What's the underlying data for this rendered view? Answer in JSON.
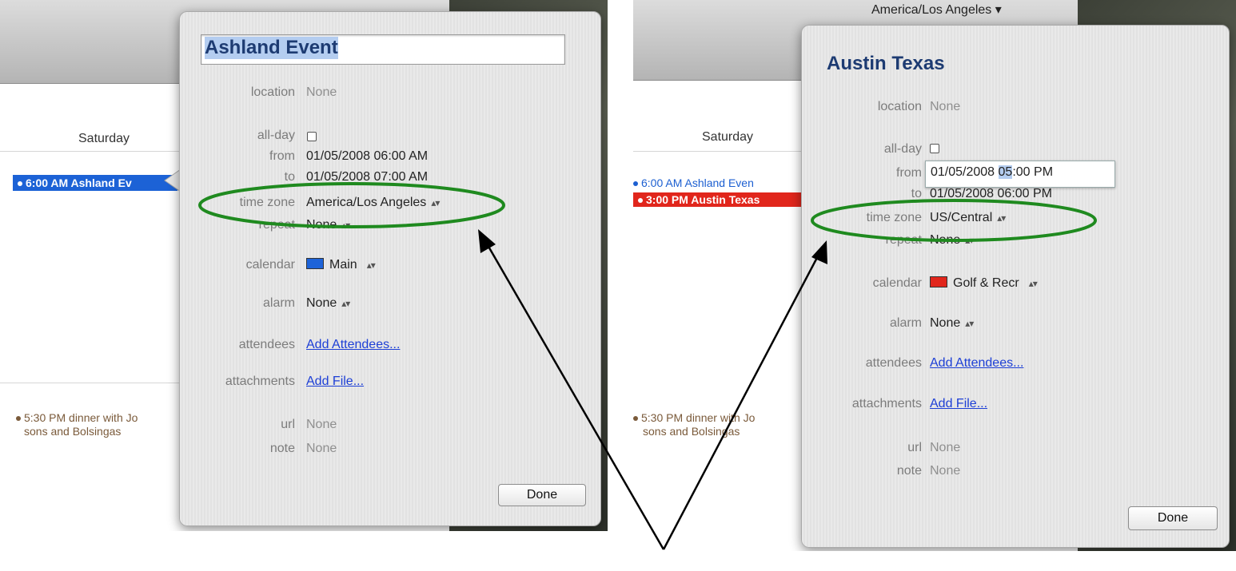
{
  "left": {
    "calendar": {
      "day_name": "Saturday",
      "event_selected": "6:00 AM Ashland Ev",
      "event_dinner_line1": "5:30 PM dinner with Jo",
      "event_dinner_line2": "sons and Bolsingas",
      "colors": {
        "selected_event": "#1c62d6",
        "dinner_event": "#7a5a3a"
      }
    },
    "popover": {
      "title": "Ashland Event",
      "labels": {
        "location": "location",
        "all_day": "all-day",
        "from": "from",
        "to": "to",
        "time_zone": "time zone",
        "repeat": "repeat",
        "calendar": "calendar",
        "alarm": "alarm",
        "attendees": "attendees",
        "attachments": "attachments",
        "url": "url",
        "note": "note"
      },
      "values": {
        "location": "None",
        "all_day_checked": false,
        "from": "01/05/2008 06:00 AM",
        "to": "01/05/2008 07:00 AM",
        "time_zone": "America/Los Angeles",
        "repeat": "None",
        "calendar": "Main",
        "calendar_color": "#1d63d8",
        "alarm": "None",
        "attendees": "Add Attendees...",
        "attachments": "Add File...",
        "url": "None",
        "note": "None"
      },
      "done_label": "Done"
    }
  },
  "right": {
    "calendar": {
      "top_timezone": "America/Los Angeles ▾",
      "day_name": "Saturday",
      "event_ashland": "6:00 AM Ashland Even",
      "event_selected": "3:00 PM Austin Texas",
      "event_dinner_line1": "5:30 PM dinner with Jo",
      "event_dinner_line2": "sons and Bolsingas",
      "colors": {
        "selected_event": "#e1261c",
        "ashland_event": "#1c5fd1",
        "dinner_event": "#7a5a3a"
      }
    },
    "popover": {
      "title": "Austin Texas",
      "labels": {
        "location": "location",
        "all_day": "all-day",
        "from": "from",
        "to": "to",
        "time_zone": "time zone",
        "repeat": "repeat",
        "calendar": "calendar",
        "alarm": "alarm",
        "attendees": "attendees",
        "attachments": "attachments",
        "url": "url",
        "note": "note"
      },
      "values": {
        "location": "None",
        "all_day_checked": false,
        "from_date": "01/05/2008",
        "from_hour": "05",
        "from_rest": ":00 PM",
        "to": "01/05/2008 06:00 PM",
        "time_zone": "US/Central",
        "repeat": "None",
        "calendar": "Golf & Recr",
        "calendar_color": "#e1261c",
        "alarm": "None",
        "attendees": "Add Attendees...",
        "attachments": "Add File...",
        "url": "None",
        "note": "None"
      },
      "done_label": "Done"
    }
  },
  "annotation": {
    "ellipse_color": "#1f8a1f",
    "arrow_color": "#000000"
  }
}
